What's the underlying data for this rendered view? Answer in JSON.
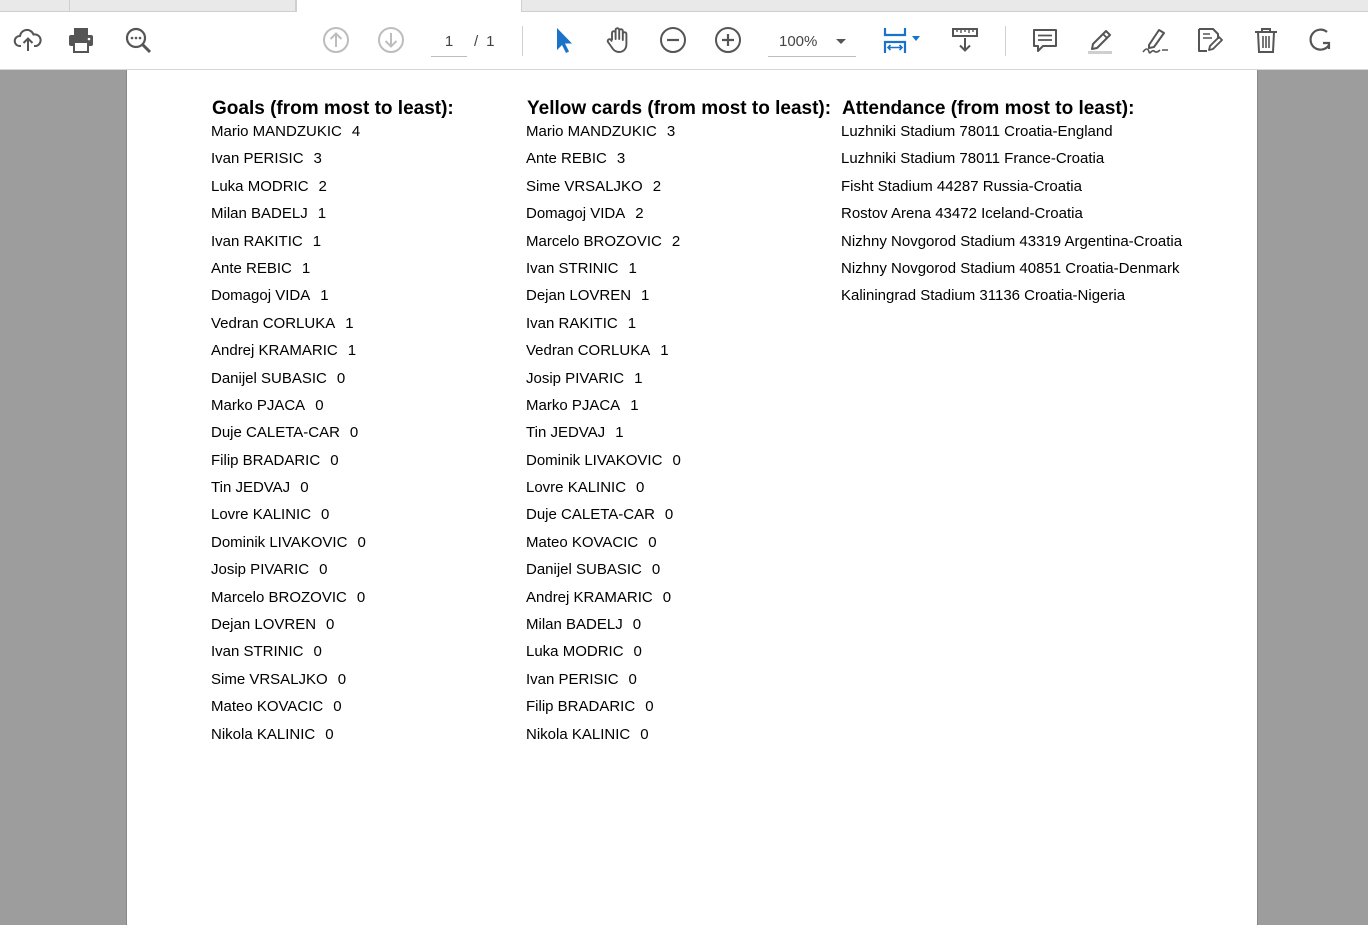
{
  "toolbar": {
    "current_page": "1",
    "page_separator": "/",
    "total_pages": "1",
    "zoom": "100%",
    "accent_color": "#1a73c9",
    "icons": [
      "cloud-upload-icon",
      "print-icon",
      "zoom-search-icon",
      "page-up-icon",
      "page-down-icon",
      "select-cursor-icon",
      "hand-icon",
      "zoom-out-icon",
      "zoom-in-icon",
      "fit-page-icon",
      "scroll-mode-icon",
      "comment-icon",
      "highlight-icon",
      "sign-icon",
      "edit-icon",
      "delete-icon",
      "rotate-icon"
    ]
  },
  "document": {
    "goals": {
      "title": "Goals (from most to least):",
      "rows": [
        {
          "name": "Mario MANDZUKIC",
          "value": "4"
        },
        {
          "name": "Ivan PERISIC",
          "value": "3"
        },
        {
          "name": "Luka MODRIC",
          "value": "2"
        },
        {
          "name": "Milan BADELJ",
          "value": "1"
        },
        {
          "name": "Ivan RAKITIC",
          "value": "1"
        },
        {
          "name": "Ante REBIC",
          "value": "1"
        },
        {
          "name": "Domagoj VIDA",
          "value": "1"
        },
        {
          "name": "Vedran CORLUKA",
          "value": "1"
        },
        {
          "name": "Andrej KRAMARIC",
          "value": "1"
        },
        {
          "name": "Danijel SUBASIC",
          "value": "0"
        },
        {
          "name": "Marko PJACA",
          "value": "0"
        },
        {
          "name": "Duje CALETA-CAR",
          "value": "0"
        },
        {
          "name": "Filip BRADARIC",
          "value": "0"
        },
        {
          "name": "Tin JEDVAJ",
          "value": "0"
        },
        {
          "name": "Lovre KALINIC",
          "value": "0"
        },
        {
          "name": "Dominik LIVAKOVIC",
          "value": "0"
        },
        {
          "name": "Josip PIVARIC",
          "value": "0"
        },
        {
          "name": "Marcelo BROZOVIC",
          "value": "0"
        },
        {
          "name": "Dejan LOVREN",
          "value": "0"
        },
        {
          "name": "Ivan STRINIC",
          "value": "0"
        },
        {
          "name": "Sime VRSALJKO",
          "value": "0"
        },
        {
          "name": "Mateo KOVACIC",
          "value": "0"
        },
        {
          "name": "Nikola KALINIC",
          "value": "0"
        }
      ]
    },
    "yellow_cards": {
      "title": "Yellow cards (from most to least):",
      "rows": [
        {
          "name": "Mario MANDZUKIC",
          "value": "3"
        },
        {
          "name": "Ante REBIC",
          "value": "3"
        },
        {
          "name": "Sime VRSALJKO",
          "value": "2"
        },
        {
          "name": "Domagoj VIDA",
          "value": "2"
        },
        {
          "name": "Marcelo BROZOVIC",
          "value": "2"
        },
        {
          "name": "Ivan STRINIC",
          "value": "1"
        },
        {
          "name": "Dejan LOVREN",
          "value": "1"
        },
        {
          "name": "Ivan RAKITIC",
          "value": "1"
        },
        {
          "name": "Vedran CORLUKA",
          "value": "1"
        },
        {
          "name": "Josip PIVARIC",
          "value": "1"
        },
        {
          "name": "Marko PJACA",
          "value": "1"
        },
        {
          "name": "Tin JEDVAJ",
          "value": "1"
        },
        {
          "name": "Dominik LIVAKOVIC",
          "value": "0"
        },
        {
          "name": "Lovre KALINIC",
          "value": "0"
        },
        {
          "name": "Duje CALETA-CAR",
          "value": "0"
        },
        {
          "name": "Mateo KOVACIC",
          "value": "0"
        },
        {
          "name": "Danijel SUBASIC",
          "value": "0"
        },
        {
          "name": "Andrej KRAMARIC",
          "value": "0"
        },
        {
          "name": "Milan BADELJ",
          "value": "0"
        },
        {
          "name": "Luka MODRIC",
          "value": "0"
        },
        {
          "name": "Ivan PERISIC",
          "value": "0"
        },
        {
          "name": "Filip BRADARIC",
          "value": "0"
        },
        {
          "name": "Nikola KALINIC",
          "value": "0"
        }
      ]
    },
    "attendance": {
      "title": "Attendance (from most to least):",
      "rows": [
        "Luzhniki Stadium 78011 Croatia-England",
        "Luzhniki Stadium 78011 France-Croatia",
        "Fisht Stadium 44287 Russia-Croatia",
        "Rostov Arena 43472 Iceland-Croatia",
        "Nizhny Novgorod Stadium 43319 Argentina-Croatia",
        "Nizhny Novgorod Stadium 40851 Croatia-Denmark",
        "Kaliningrad Stadium 31136 Croatia-Nigeria"
      ]
    }
  }
}
